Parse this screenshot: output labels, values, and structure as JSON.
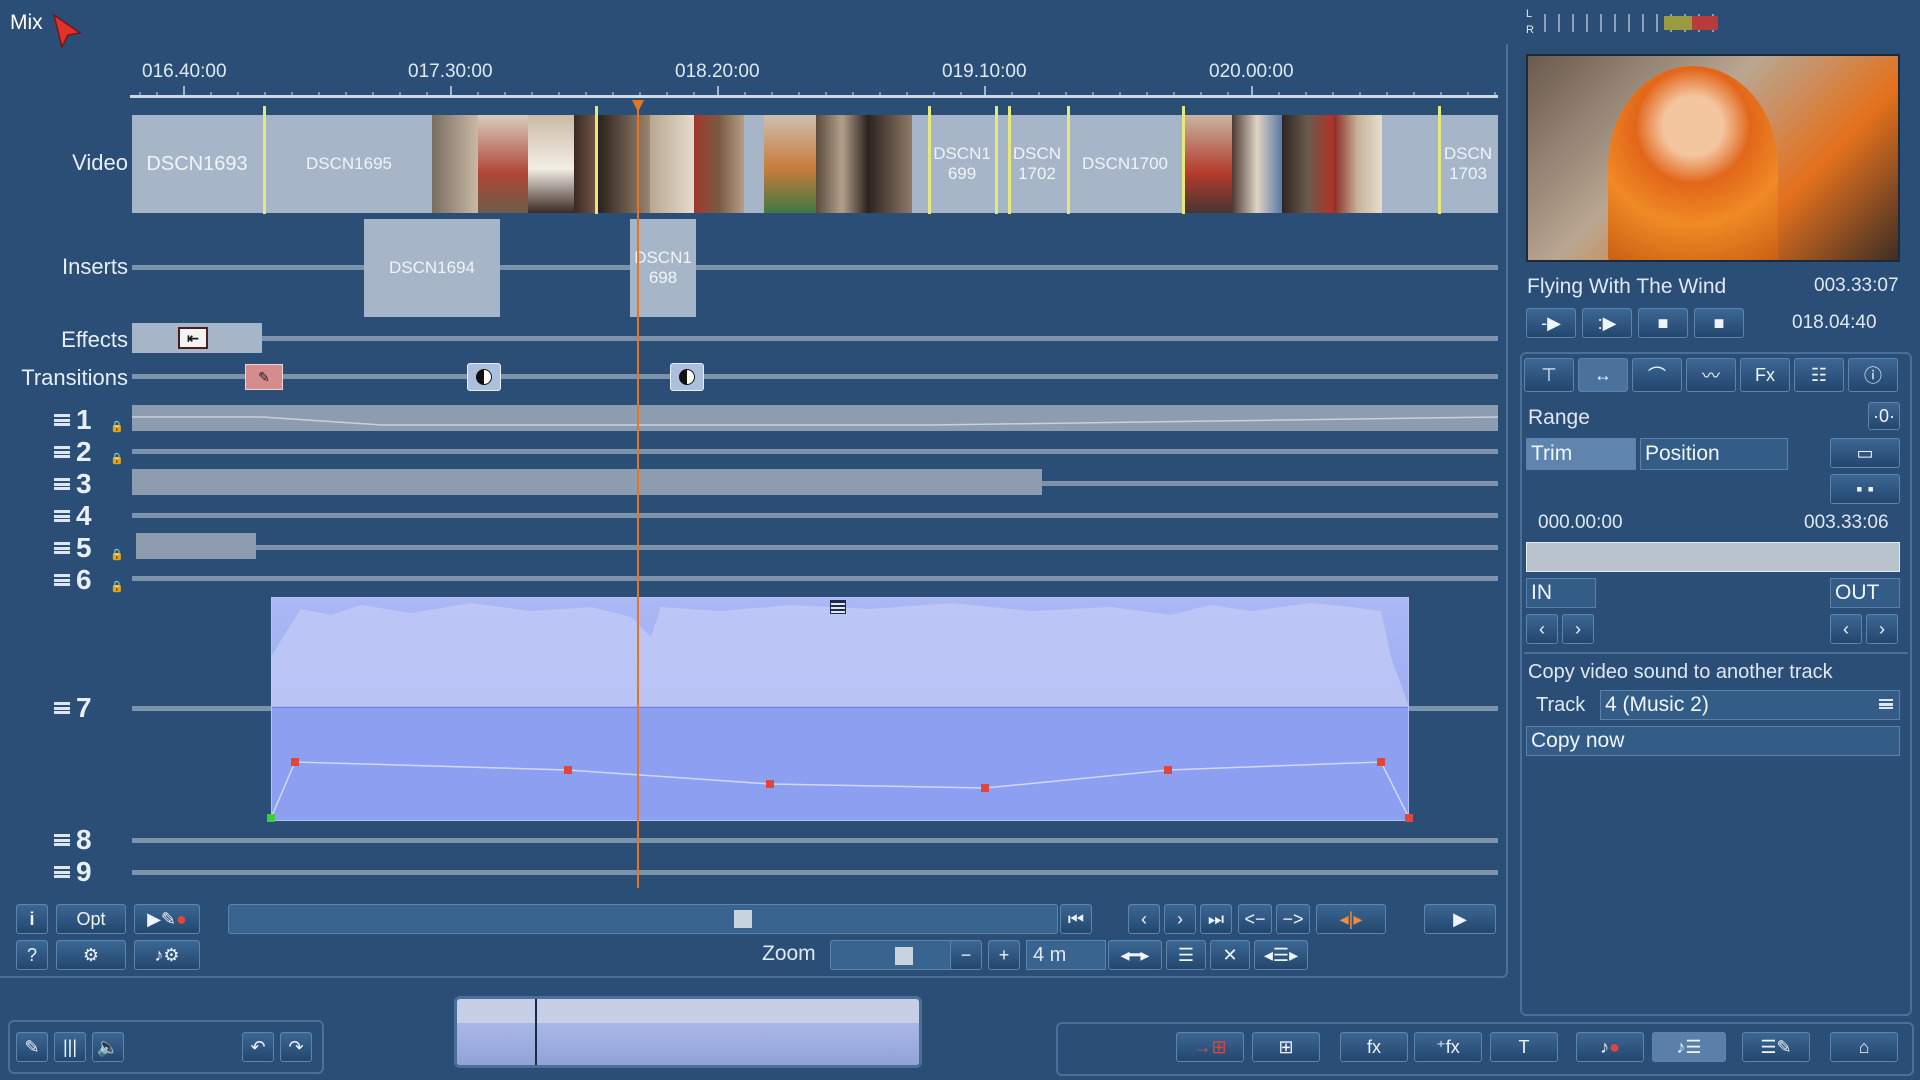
{
  "header": {
    "mode": "Mix"
  },
  "meter": {
    "left": "L",
    "right": "R"
  },
  "timeline": {
    "ruler_labels": [
      "016.40:00",
      "017.30:00",
      "018.20:00",
      "019.10:00",
      "020.00:00"
    ],
    "track_labels": {
      "video": "Video",
      "inserts": "Inserts",
      "effects": "Effects",
      "transitions": "Transitions"
    },
    "video_clips": [
      "DSCN1693",
      "DSCN1695",
      "DSCN1 699",
      "DSCN 1702",
      "DSCN1700",
      "DSCN 1703"
    ],
    "insert_clips": [
      "DSCN1694",
      "DSCN1 698"
    ],
    "audio_tracks": [
      "1",
      "2",
      "3",
      "4",
      "5",
      "6",
      "7",
      "8",
      "9"
    ]
  },
  "bottom_controls": {
    "info": "i",
    "opt": "Opt",
    "help": "?",
    "zoom_label": "Zoom",
    "zoom_minus": "−",
    "zoom_plus": "+",
    "zoom_value": "4 m"
  },
  "preview": {
    "title": "Flying With The Wind",
    "duration": "003.33:07",
    "timecode": "018.04:40"
  },
  "panel": {
    "tabs": [
      "hook-icon",
      "range-icon",
      "fade-icon",
      "curve-icon",
      "Fx",
      "mixer-icon",
      "info-icon"
    ],
    "fx_label": "Fx",
    "section": "Range",
    "trim": "Trim",
    "position": "Position",
    "start_time": "000.00:00",
    "end_time": "003.33:06",
    "in_label": "IN",
    "out_label": "OUT",
    "copy_heading": "Copy video sound to another track",
    "track_label": "Track",
    "track_value": "4 (Music 2)",
    "copy_button": "Copy now"
  },
  "colors": {
    "background": "#2a4e76",
    "playhead": "#e8741e",
    "audio_fill": "#8d9ff0",
    "clip": "#a6b6c8",
    "marker": "#e7e87a"
  }
}
